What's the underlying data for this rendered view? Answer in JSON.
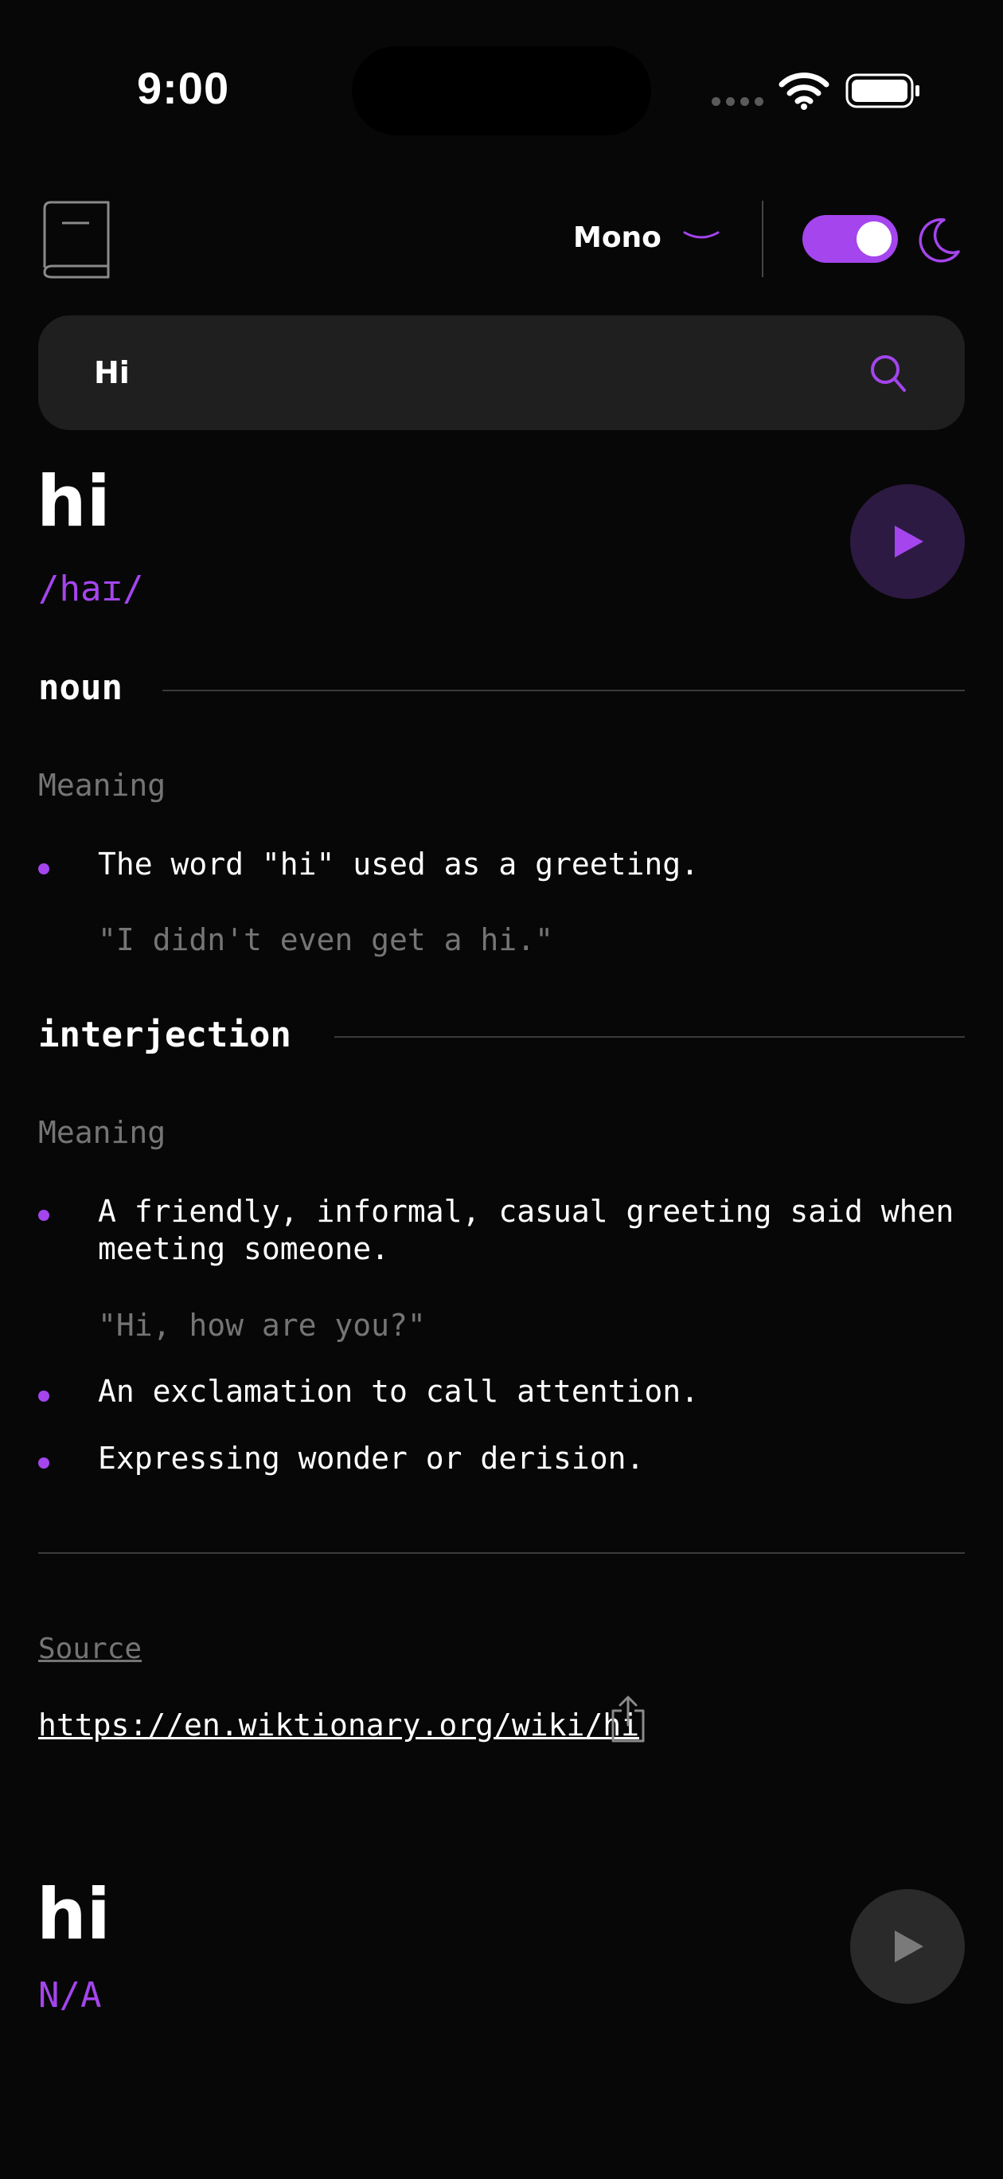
{
  "status_bar": {
    "time": "9:00"
  },
  "header": {
    "font_selector": "Mono",
    "dark_mode": true
  },
  "search": {
    "value": "Hi"
  },
  "entries": [
    {
      "word": "hi",
      "phonetic": "/haɪ/",
      "meanings": [
        {
          "part_of_speech": "noun",
          "label": "Meaning",
          "definitions": [
            {
              "text": "The word \"hi\" used as a greeting.",
              "example": "\"I didn't even get a hi.\""
            }
          ]
        },
        {
          "part_of_speech": "interjection",
          "label": "Meaning",
          "definitions": [
            {
              "text": "A friendly, informal, casual greeting said when meeting someone.",
              "example": "\"Hi, how are you?\""
            },
            {
              "text": "An exclamation to call attention."
            },
            {
              "text": "Expressing wonder or derision."
            }
          ]
        }
      ],
      "source_label": "Source",
      "source_url": "https://en.wiktionary.org/wiki/hi"
    },
    {
      "word": "hi",
      "phonetic": "N/A"
    }
  ],
  "colors": {
    "accent": "#a445ed",
    "background": "#070707",
    "muted": "#757575"
  }
}
